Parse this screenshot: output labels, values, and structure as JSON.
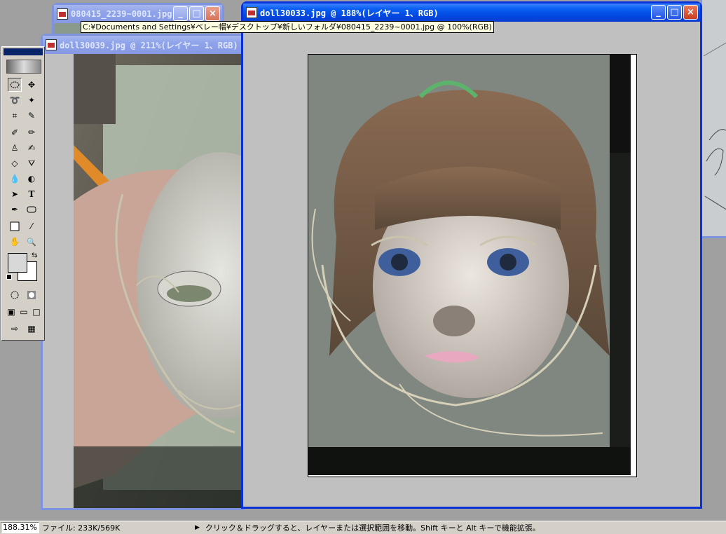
{
  "windows": {
    "back": {
      "title": "080415_2239~0001.jpg"
    },
    "middle": {
      "title": "doll30039.jpg @ 211%(レイヤー 1、RGB)"
    },
    "front": {
      "title": "doll30033.jpg @ 188%(レイヤー 1、RGB)"
    }
  },
  "tooltip": "C:¥Documents and Settings¥ベレー帽¥デスクトップ¥新しいフォルダ¥080415_2239~0001.jpg @ 100%(RGB)",
  "window_buttons": {
    "minimize": "_",
    "maximize": "□",
    "close": "×"
  },
  "statusbar": {
    "zoom": "188.31%",
    "file_info": "ファイル: 233K/569K",
    "arrow": "▶",
    "hint": "クリック＆ドラッグすると、レイヤーまたは選択範囲を移動。Shift キーと Alt キーで機能拡張。"
  },
  "tools": [
    "marquee-tool",
    "move-tool",
    "lasso-tool",
    "magic-wand-tool",
    "crop-tool",
    "eyedropper-slice-tool",
    "brush-tool",
    "pencil-tool",
    "clone-stamp-tool",
    "history-brush-tool",
    "eraser-tool",
    "paint-bucket-tool",
    "blur-tool",
    "dodge-tool",
    "path-select-tool",
    "type-tool",
    "pen-tool",
    "shape-tool",
    "notes-tool",
    "eyedropper-tool",
    "hand-tool",
    "zoom-tool"
  ],
  "tool_glyphs": {
    "type": "T",
    "zoom": "🔍"
  },
  "colors": {
    "xp_active_title": "#0a5ff2",
    "xp_inactive_title": "#8ea3ea",
    "workspace": "#a0a0a0",
    "palette_bg": "#d4d0c8"
  }
}
